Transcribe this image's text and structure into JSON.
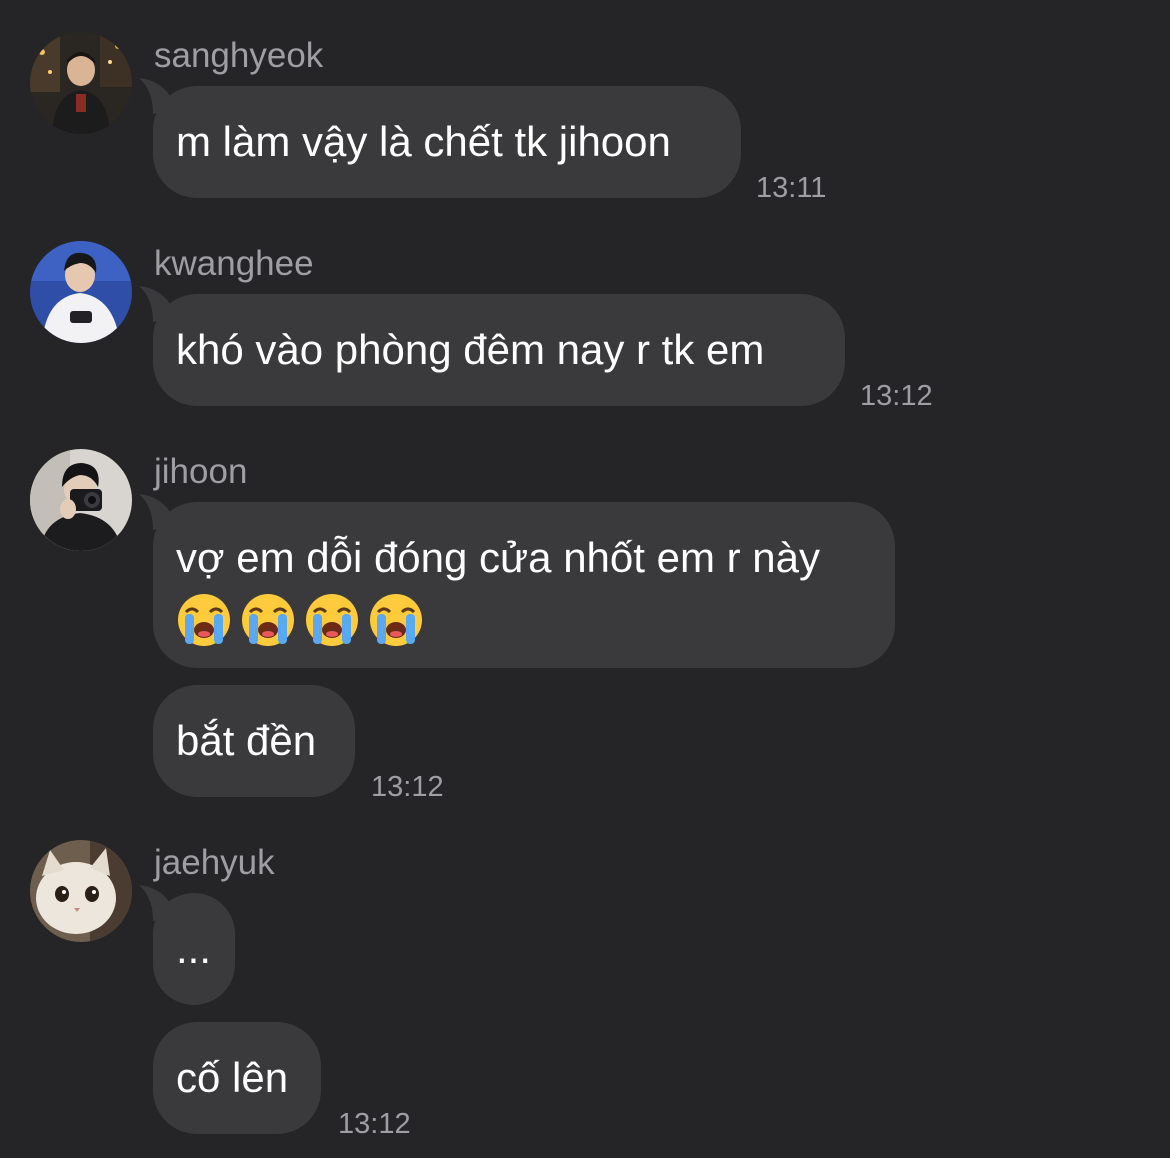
{
  "messages": [
    {
      "sender": "sanghyeok",
      "avatar_icon": "person-night-city-avatar",
      "bubbles": [
        {
          "text": "m làm vậy là chết tk jihoon",
          "time": "13:11"
        }
      ]
    },
    {
      "sender": "kwanghee",
      "avatar_icon": "person-white-jacket-avatar",
      "bubbles": [
        {
          "text": "khó vào phòng đêm nay r tk em",
          "time": "13:12"
        }
      ]
    },
    {
      "sender": "jihoon",
      "avatar_icon": "person-camera-avatar",
      "bubbles": [
        {
          "text": "vợ em dỗi đóng cửa nhốt em r này",
          "emoji": [
            "loudly-crying-face",
            "loudly-crying-face",
            "loudly-crying-face",
            "loudly-crying-face"
          ],
          "time": ""
        },
        {
          "text": "bắt đền",
          "time": "13:12"
        }
      ]
    },
    {
      "sender": "jaehyuk",
      "avatar_icon": "white-cat-avatar",
      "bubbles": [
        {
          "text": "...",
          "time": ""
        },
        {
          "text": "cố lên",
          "time": "13:12"
        }
      ]
    }
  ],
  "colors": {
    "background": "#252527",
    "bubble": "#3a3a3c",
    "secondary_text": "#9e9ea3"
  }
}
